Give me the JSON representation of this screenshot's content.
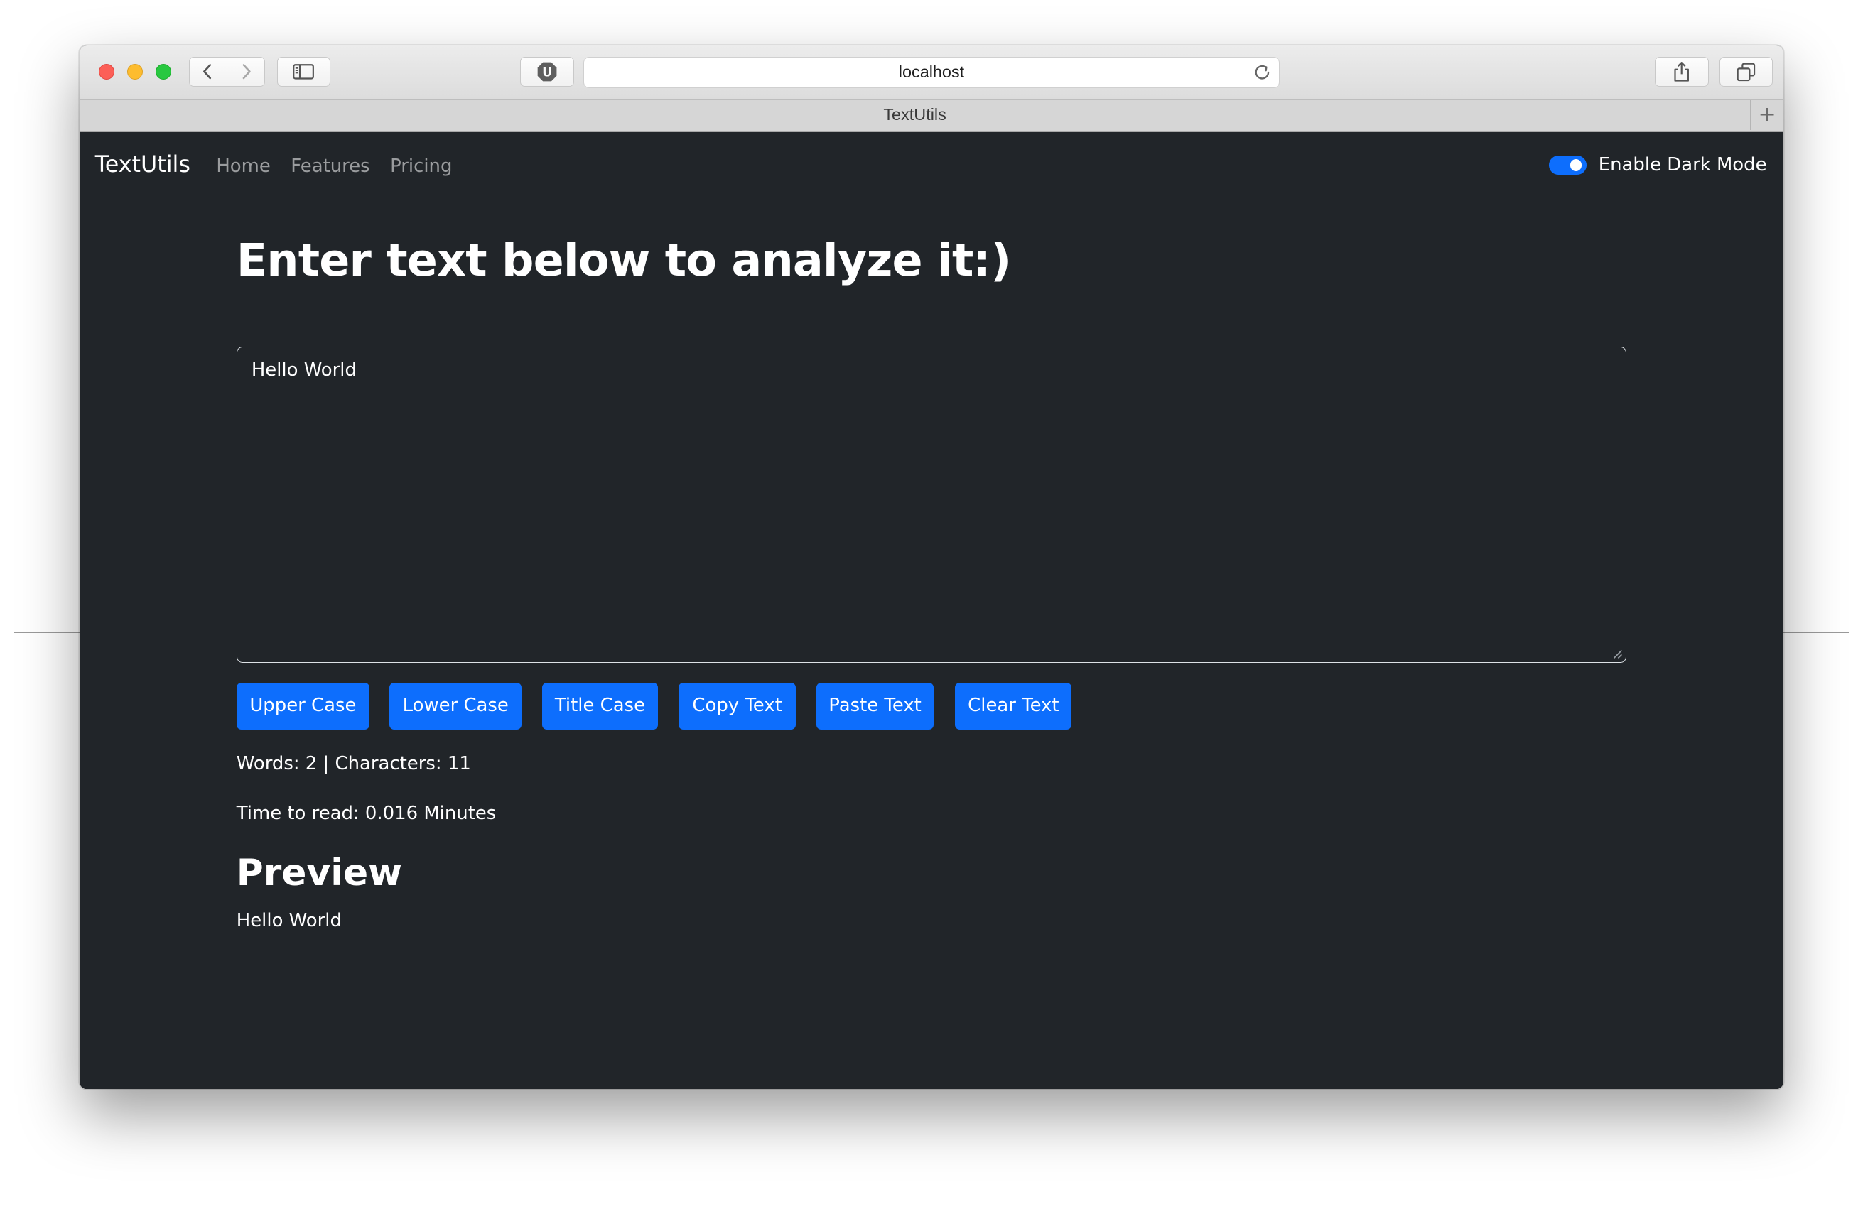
{
  "browser": {
    "url": "localhost",
    "tab_title": "TextUtils",
    "new_tab_symbol": "+",
    "extension_letter": "U"
  },
  "navbar": {
    "brand": "TextUtils",
    "links": [
      {
        "label": "Home"
      },
      {
        "label": "Features"
      },
      {
        "label": "Pricing"
      }
    ],
    "dark_mode": {
      "label": "Enable Dark Mode",
      "enabled": true
    }
  },
  "main": {
    "heading": "Enter text below to analyze it:)",
    "textarea_value": "Hello World",
    "buttons": [
      {
        "label": "Upper Case"
      },
      {
        "label": "Lower Case"
      },
      {
        "label": "Title Case"
      },
      {
        "label": "Copy Text"
      },
      {
        "label": "Paste Text"
      },
      {
        "label": "Clear Text"
      }
    ],
    "summary": "Words: 2 | Characters: 11",
    "read_time": "Time to read: 0.016 Minutes",
    "preview_heading": "Preview",
    "preview_text": "Hello World"
  },
  "colors": {
    "page_bg": "#212529",
    "primary": "#0d6efd",
    "text": "#ffffff",
    "nav_muted": "rgba(255,255,255,0.55)"
  },
  "icons": [
    "chevron-left-icon",
    "chevron-right-icon",
    "sidebar-icon",
    "extension-icon",
    "reload-icon",
    "share-icon",
    "tabs-overview-icon",
    "resize-grip-icon"
  ]
}
